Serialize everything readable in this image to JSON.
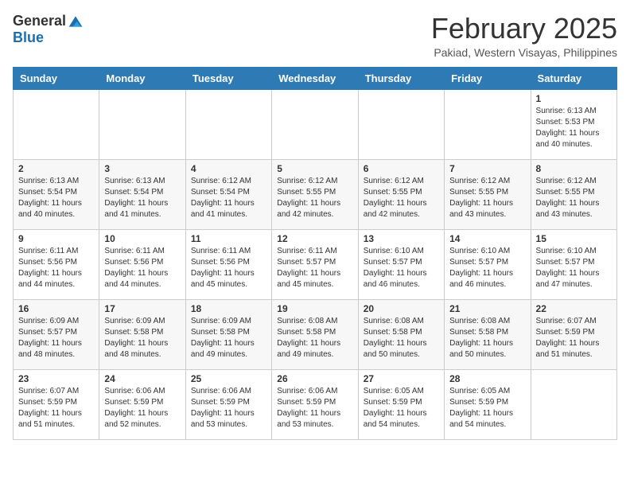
{
  "header": {
    "logo_general": "General",
    "logo_blue": "Blue",
    "month_title": "February 2025",
    "location": "Pakiad, Western Visayas, Philippines"
  },
  "weekdays": [
    "Sunday",
    "Monday",
    "Tuesday",
    "Wednesday",
    "Thursday",
    "Friday",
    "Saturday"
  ],
  "weeks": [
    [
      {
        "day": "",
        "info": ""
      },
      {
        "day": "",
        "info": ""
      },
      {
        "day": "",
        "info": ""
      },
      {
        "day": "",
        "info": ""
      },
      {
        "day": "",
        "info": ""
      },
      {
        "day": "",
        "info": ""
      },
      {
        "day": "1",
        "info": "Sunrise: 6:13 AM\nSunset: 5:53 PM\nDaylight: 11 hours\nand 40 minutes."
      }
    ],
    [
      {
        "day": "2",
        "info": "Sunrise: 6:13 AM\nSunset: 5:54 PM\nDaylight: 11 hours\nand 40 minutes."
      },
      {
        "day": "3",
        "info": "Sunrise: 6:13 AM\nSunset: 5:54 PM\nDaylight: 11 hours\nand 41 minutes."
      },
      {
        "day": "4",
        "info": "Sunrise: 6:12 AM\nSunset: 5:54 PM\nDaylight: 11 hours\nand 41 minutes."
      },
      {
        "day": "5",
        "info": "Sunrise: 6:12 AM\nSunset: 5:55 PM\nDaylight: 11 hours\nand 42 minutes."
      },
      {
        "day": "6",
        "info": "Sunrise: 6:12 AM\nSunset: 5:55 PM\nDaylight: 11 hours\nand 42 minutes."
      },
      {
        "day": "7",
        "info": "Sunrise: 6:12 AM\nSunset: 5:55 PM\nDaylight: 11 hours\nand 43 minutes."
      },
      {
        "day": "8",
        "info": "Sunrise: 6:12 AM\nSunset: 5:55 PM\nDaylight: 11 hours\nand 43 minutes."
      }
    ],
    [
      {
        "day": "9",
        "info": "Sunrise: 6:11 AM\nSunset: 5:56 PM\nDaylight: 11 hours\nand 44 minutes."
      },
      {
        "day": "10",
        "info": "Sunrise: 6:11 AM\nSunset: 5:56 PM\nDaylight: 11 hours\nand 44 minutes."
      },
      {
        "day": "11",
        "info": "Sunrise: 6:11 AM\nSunset: 5:56 PM\nDaylight: 11 hours\nand 45 minutes."
      },
      {
        "day": "12",
        "info": "Sunrise: 6:11 AM\nSunset: 5:57 PM\nDaylight: 11 hours\nand 45 minutes."
      },
      {
        "day": "13",
        "info": "Sunrise: 6:10 AM\nSunset: 5:57 PM\nDaylight: 11 hours\nand 46 minutes."
      },
      {
        "day": "14",
        "info": "Sunrise: 6:10 AM\nSunset: 5:57 PM\nDaylight: 11 hours\nand 46 minutes."
      },
      {
        "day": "15",
        "info": "Sunrise: 6:10 AM\nSunset: 5:57 PM\nDaylight: 11 hours\nand 47 minutes."
      }
    ],
    [
      {
        "day": "16",
        "info": "Sunrise: 6:09 AM\nSunset: 5:57 PM\nDaylight: 11 hours\nand 48 minutes."
      },
      {
        "day": "17",
        "info": "Sunrise: 6:09 AM\nSunset: 5:58 PM\nDaylight: 11 hours\nand 48 minutes."
      },
      {
        "day": "18",
        "info": "Sunrise: 6:09 AM\nSunset: 5:58 PM\nDaylight: 11 hours\nand 49 minutes."
      },
      {
        "day": "19",
        "info": "Sunrise: 6:08 AM\nSunset: 5:58 PM\nDaylight: 11 hours\nand 49 minutes."
      },
      {
        "day": "20",
        "info": "Sunrise: 6:08 AM\nSunset: 5:58 PM\nDaylight: 11 hours\nand 50 minutes."
      },
      {
        "day": "21",
        "info": "Sunrise: 6:08 AM\nSunset: 5:58 PM\nDaylight: 11 hours\nand 50 minutes."
      },
      {
        "day": "22",
        "info": "Sunrise: 6:07 AM\nSunset: 5:59 PM\nDaylight: 11 hours\nand 51 minutes."
      }
    ],
    [
      {
        "day": "23",
        "info": "Sunrise: 6:07 AM\nSunset: 5:59 PM\nDaylight: 11 hours\nand 51 minutes."
      },
      {
        "day": "24",
        "info": "Sunrise: 6:06 AM\nSunset: 5:59 PM\nDaylight: 11 hours\nand 52 minutes."
      },
      {
        "day": "25",
        "info": "Sunrise: 6:06 AM\nSunset: 5:59 PM\nDaylight: 11 hours\nand 53 minutes."
      },
      {
        "day": "26",
        "info": "Sunrise: 6:06 AM\nSunset: 5:59 PM\nDaylight: 11 hours\nand 53 minutes."
      },
      {
        "day": "27",
        "info": "Sunrise: 6:05 AM\nSunset: 5:59 PM\nDaylight: 11 hours\nand 54 minutes."
      },
      {
        "day": "28",
        "info": "Sunrise: 6:05 AM\nSunset: 5:59 PM\nDaylight: 11 hours\nand 54 minutes."
      },
      {
        "day": "",
        "info": ""
      }
    ]
  ]
}
